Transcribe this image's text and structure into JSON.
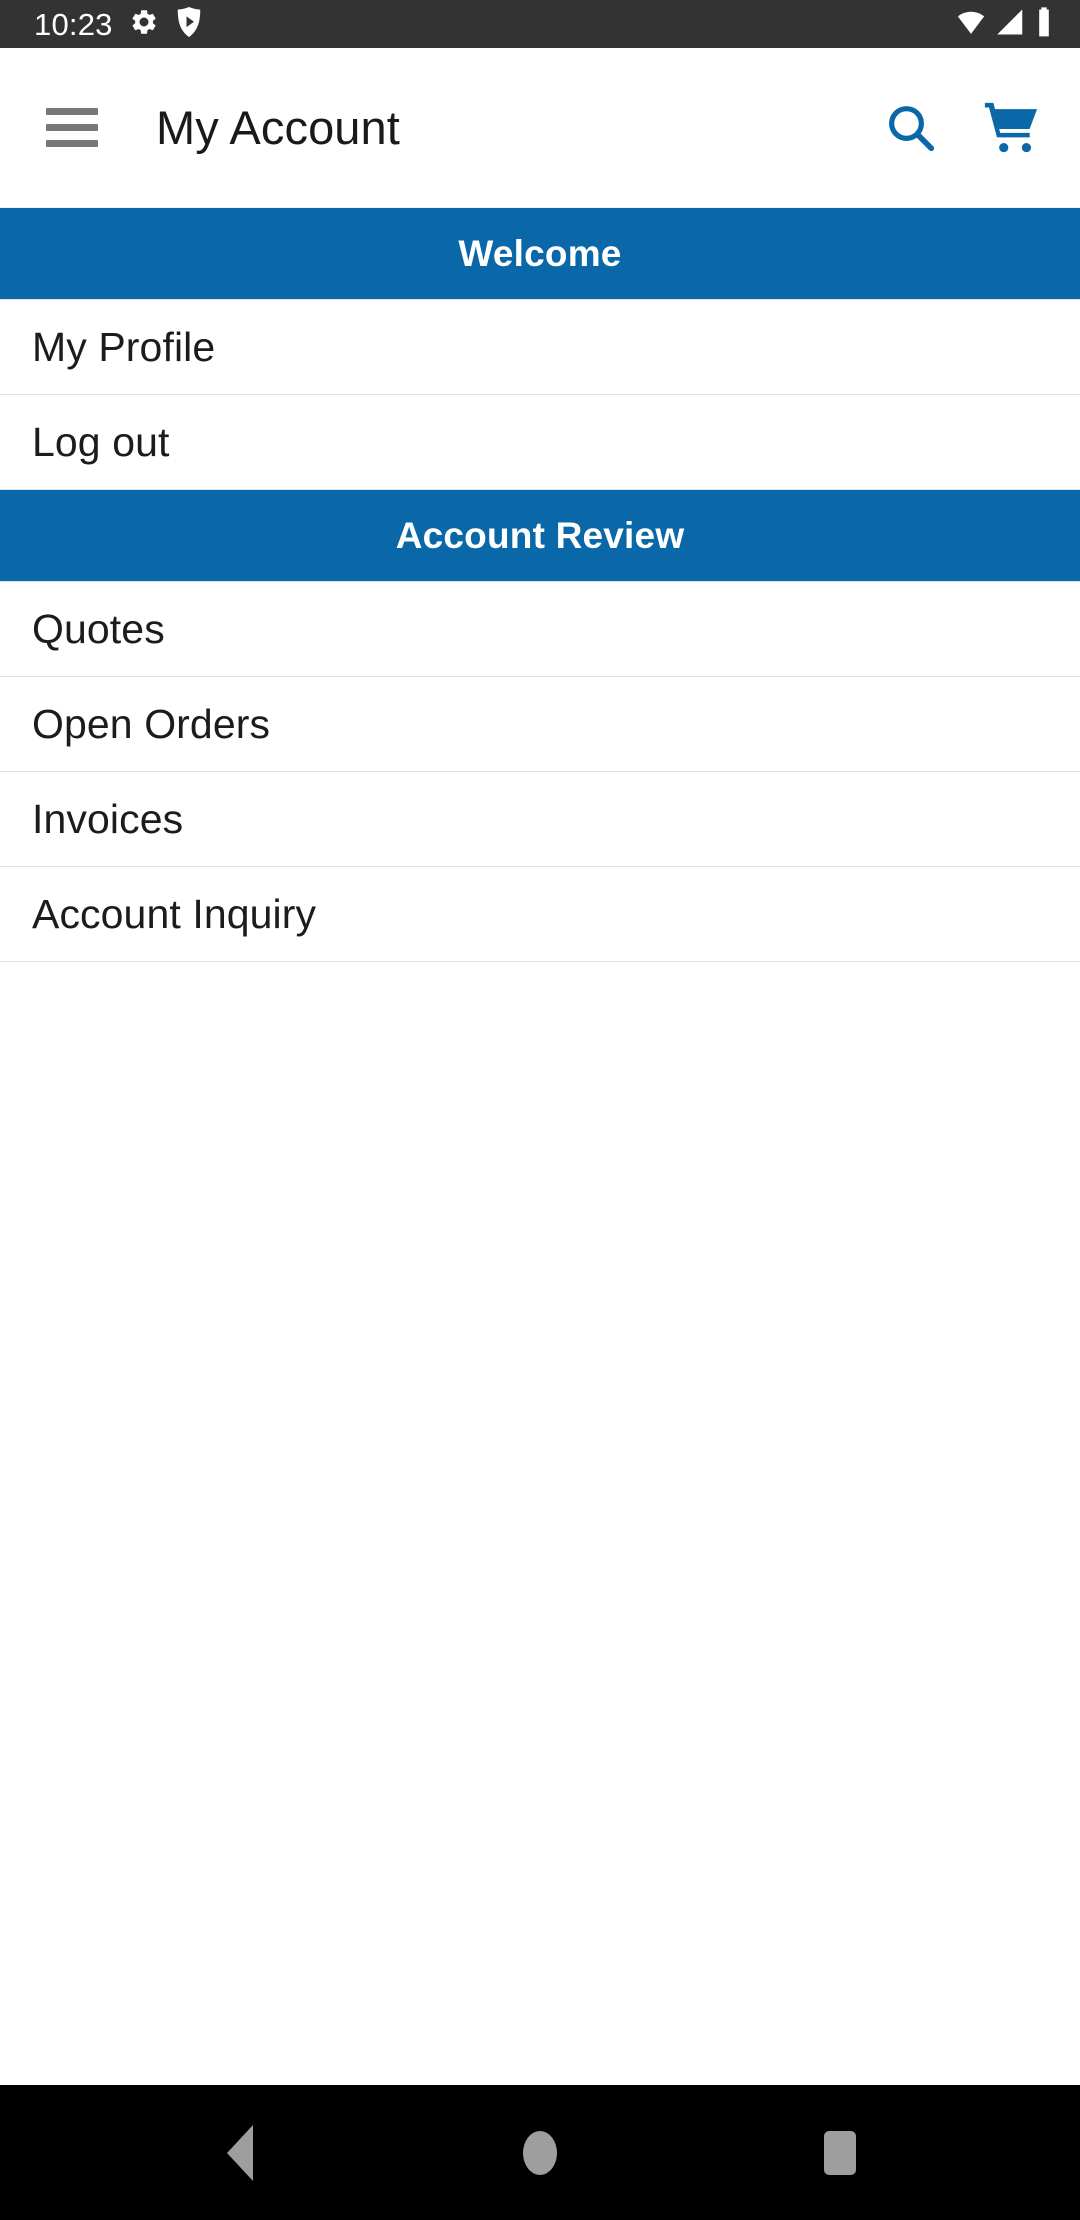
{
  "status_bar": {
    "time": "10:23",
    "left_icons": [
      "gear-icon",
      "shield-play-icon"
    ],
    "right_icons": [
      "wifi-icon",
      "cellular-signal-icon",
      "battery-icon"
    ],
    "background_color": "#333333",
    "foreground_color": "#ffffff"
  },
  "app_bar": {
    "menu_icon": "hamburger-menu-icon",
    "title": "My Account",
    "actions": [
      {
        "name": "search-icon",
        "label": "Search"
      },
      {
        "name": "shopping-cart-icon",
        "label": "Cart"
      }
    ],
    "accent_color": "#0b68a8",
    "title_color": "#1a1a1a"
  },
  "sections": [
    {
      "header": "Welcome",
      "items": [
        {
          "label": "My Profile"
        },
        {
          "label": "Log out"
        }
      ]
    },
    {
      "header": "Account Review",
      "items": [
        {
          "label": "Quotes"
        },
        {
          "label": "Open Orders"
        },
        {
          "label": "Invoices"
        },
        {
          "label": "Account Inquiry"
        }
      ]
    }
  ],
  "nav_bar": {
    "buttons": [
      {
        "name": "nav-back-button",
        "label": "Back"
      },
      {
        "name": "nav-home-button",
        "label": "Home"
      },
      {
        "name": "nav-recents-button",
        "label": "Recent apps"
      }
    ],
    "background_color": "#000000",
    "icon_color": "#9e9e9e"
  }
}
